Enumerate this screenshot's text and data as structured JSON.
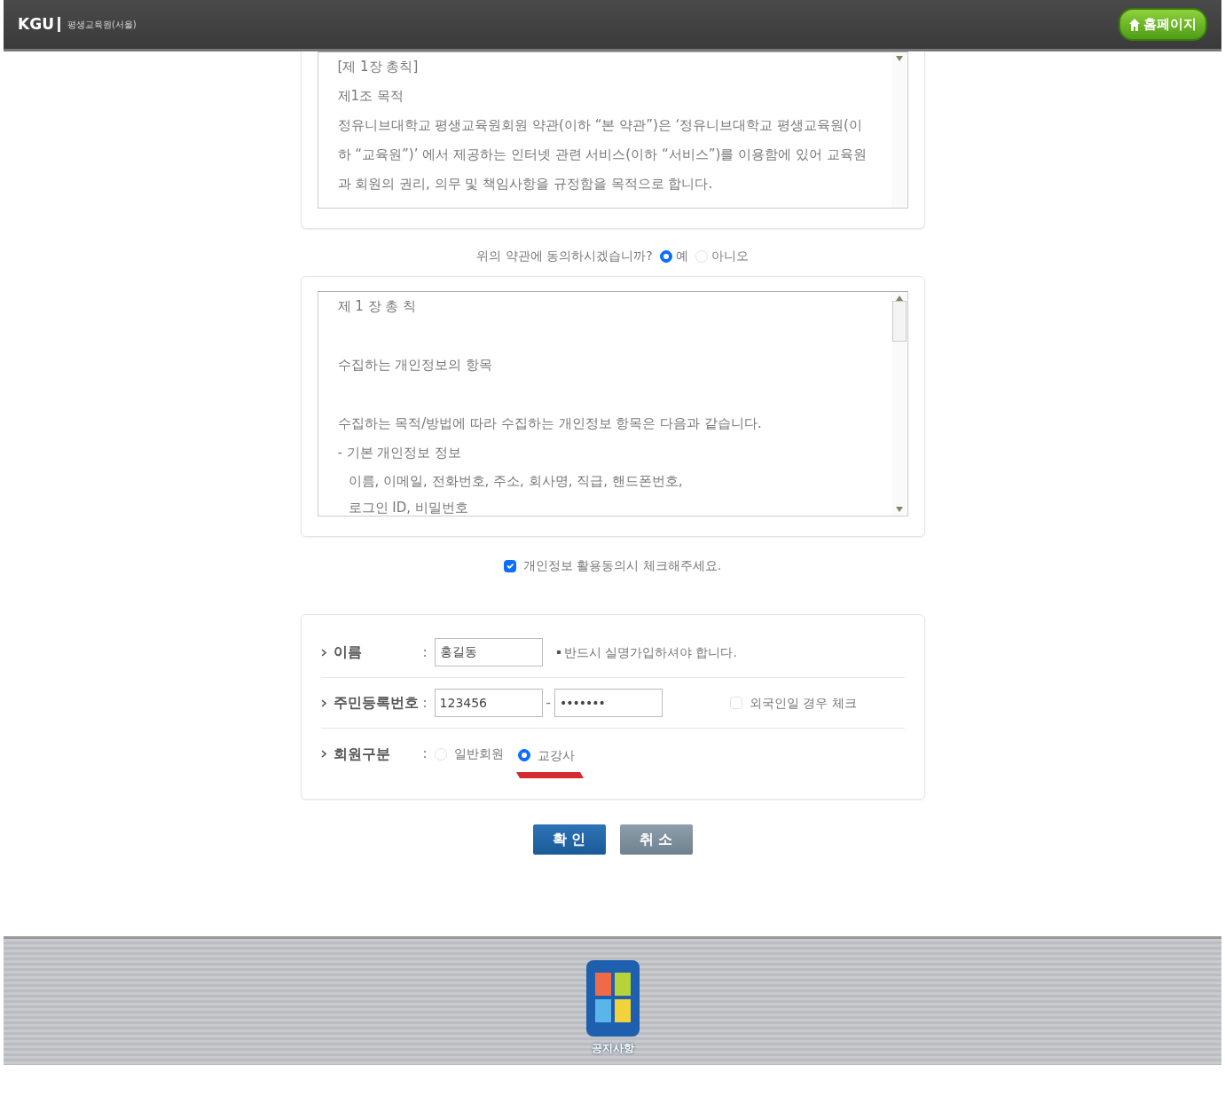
{
  "header": {
    "logo": "KGU",
    "site_name": "평생교육원(서울)",
    "home_button": "홈페이지"
  },
  "terms_box": {
    "lines": [
      {
        "text": "[제 1장 총칙]"
      },
      {
        "text": "제1조 목적"
      },
      {
        "text": "정유니브대학교 평생교육원회원 약관(이하 “본 약관”)은 ‘정유니브대학교 평생교육원(이하 “교육원”)’ 에서 제공하는 인터넷 관련 서비스(이하 “서비스”)를 이용함에 있어 교육원과 회원의 권리, 의무 및 책임사항을 규정함을 목적으로 합니다."
      }
    ]
  },
  "terms_question": {
    "text": "위의 약관에 동의하시겠습니까?",
    "options": [
      {
        "label": "예",
        "selected": true
      },
      {
        "label": "아니오",
        "selected": false
      }
    ]
  },
  "privacy_box": {
    "lines": [
      {
        "text": "제 1 장 총 칙",
        "spaced": false,
        "indent": false
      },
      {
        "text": "수집하는 개인정보의 항목",
        "spaced": true,
        "indent": false
      },
      {
        "text": "수집하는 목적/방법에 따라 수집하는 개인정보 항목은 다음과 같습니다.",
        "spaced": true,
        "indent": false
      },
      {
        "text": "- 기본 개인정보 정보",
        "spaced": false,
        "indent": false
      },
      {
        "text": "이름, 이메일, 전화번호, 주소, 회사명, 직급, 핸드폰번호,",
        "spaced": false,
        "indent": true
      },
      {
        "text": "로그인 ID, 비밀번호",
        "spaced": false,
        "indent": true
      }
    ]
  },
  "privacy_consent": {
    "label": "개인정보 활용동의시 체크해주세요.",
    "checked": true
  },
  "form": {
    "rows": [
      {
        "kind": "text",
        "label": "이름",
        "separator": ":",
        "value": "홍길동",
        "note": "반드시 실명가입하셔야 합니다."
      },
      {
        "kind": "id_number",
        "label": "주민등록번호",
        "separator": ":",
        "value": "123456",
        "dash": "-",
        "masked_value": "•••••••",
        "foreigner_check": {
          "label": "외국인일 경우 체크",
          "checked": false
        }
      },
      {
        "kind": "radio",
        "label": "회원구분",
        "separator": ":",
        "options": [
          {
            "label": "일반회원",
            "selected": false
          },
          {
            "label": "교강사",
            "selected": true
          }
        ]
      }
    ]
  },
  "buttons": [
    {
      "label": "확 인",
      "kind": "primary"
    },
    {
      "label": "취 소",
      "kind": "secondary"
    }
  ],
  "dock": {
    "items": [
      {
        "label": "공지사항"
      }
    ]
  }
}
